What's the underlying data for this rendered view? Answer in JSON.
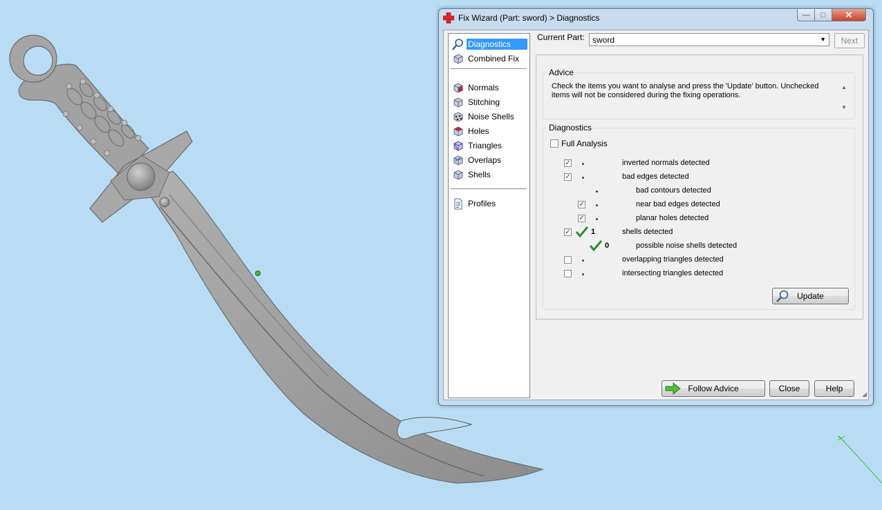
{
  "window": {
    "title": "Fix Wizard (Part: sword) > Diagnostics",
    "min_symbol": "—",
    "max_symbol": "□",
    "close_symbol": "✕"
  },
  "nav": {
    "items": [
      {
        "label": "Diagnostics",
        "icon": "magnifier-icon"
      },
      {
        "label": "Combined Fix",
        "icon": "cube-icon"
      },
      {
        "label": "Normals",
        "icon": "normals-cube-icon"
      },
      {
        "label": "Stitching",
        "icon": "stitching-cube-icon"
      },
      {
        "label": "Noise Shells",
        "icon": "noise-shells-icon"
      },
      {
        "label": "Holes",
        "icon": "holes-cube-icon"
      },
      {
        "label": "Triangles",
        "icon": "triangles-cube-icon"
      },
      {
        "label": "Overlaps",
        "icon": "overlaps-cube-icon"
      },
      {
        "label": "Shells",
        "icon": "shells-cube-icon"
      },
      {
        "label": "Profiles",
        "icon": "profile-document-icon"
      }
    ]
  },
  "part": {
    "label": "Current Part:",
    "value": "sword",
    "next_label": "Next"
  },
  "advice": {
    "title": "Advice",
    "text": "Check the items you want to analyse and press the 'Update' button. Unchecked items will not be considered during the fixing operations."
  },
  "diagnostics": {
    "title": "Diagnostics",
    "full_analysis": "Full Analysis",
    "full_analysis_checked": false,
    "rows": [
      {
        "label": "inverted normals detected",
        "checked": true,
        "status": "dot",
        "count": ""
      },
      {
        "label": "bad edges detected",
        "checked": true,
        "status": "dot",
        "count": ""
      },
      {
        "label": "bad contours detected",
        "checked": null,
        "status": "dot",
        "count": ""
      },
      {
        "label": "near bad edges detected",
        "checked": true,
        "status": "dot",
        "count": ""
      },
      {
        "label": "planar holes detected",
        "checked": true,
        "status": "dot",
        "count": ""
      },
      {
        "label": "shells detected",
        "checked": true,
        "status": "ok",
        "count": "1"
      },
      {
        "label": "possible noise shells detected",
        "checked": null,
        "status": "ok",
        "count": "0"
      },
      {
        "label": "overlapping triangles detected",
        "checked": false,
        "status": "dot",
        "count": ""
      },
      {
        "label": "intersecting triangles detected",
        "checked": false,
        "status": "dot",
        "count": ""
      }
    ],
    "update_label": "Update"
  },
  "footer": {
    "follow_advice": "Follow Advice",
    "close": "Close",
    "help": "Help"
  },
  "colors": {
    "viewport_bg": "#b9dcf5",
    "selection": "#3399ff",
    "check_green": "#2e8b2e",
    "model_gray": "#9a9a9a"
  }
}
